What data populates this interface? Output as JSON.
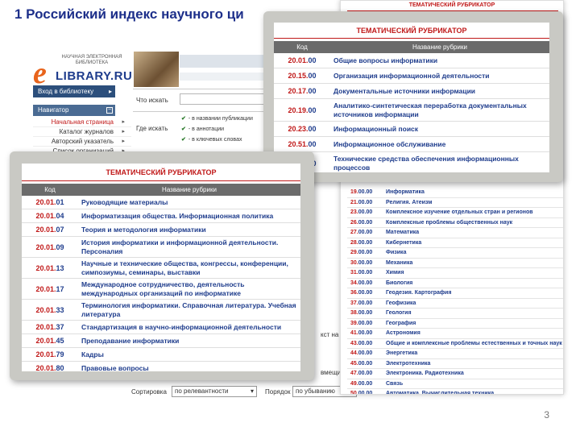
{
  "slide": {
    "title": "1 Российский индекс научного ци",
    "page_number": "3"
  },
  "elibrary": {
    "logo_small": "НАУЧНАЯ ЭЛЕКТРОННАЯ\nБИБЛИОТЕКА",
    "logo_e": "e",
    "logo_brand": "LIBRARY.RU",
    "login_button": "Вход в библиотеку",
    "navigator_header": "Навигатор",
    "nav_items": [
      {
        "label": "Начальная страница",
        "active": true
      },
      {
        "label": "Каталог журналов",
        "active": false
      },
      {
        "label": "Авторский указатель",
        "active": false
      },
      {
        "label": "Список организаций",
        "active": false
      }
    ],
    "search_label": "Что искать",
    "where_label": "Где искать",
    "where_options": [
      "- в названии публикации",
      "- в аннотации",
      "- в ключевых словах"
    ],
    "fragment_text_1": "кст на",
    "fragment_text_2": "вмещи",
    "sort_label": "Сортировка",
    "sort_value": "по релевантности",
    "order_label": "Порядок",
    "order_value": "по убыванию"
  },
  "big_rubricator": {
    "header": "ТЕМАТИЧЕСКИЙ РУБРИКАТОР",
    "rows": [
      {
        "prefix": "19.",
        "suffix": "00.00",
        "name": "Информатика"
      },
      {
        "prefix": "21.",
        "suffix": "00.00",
        "name": "Религия. Атеизм"
      },
      {
        "prefix": "23.",
        "suffix": "00.00",
        "name": "Комплексное изучение отдельных стран и регионов"
      },
      {
        "prefix": "26.",
        "suffix": "00.00",
        "name": "Комплексные проблемы общественных наук"
      },
      {
        "prefix": "27.",
        "suffix": "00.00",
        "name": "Математика"
      },
      {
        "prefix": "28.",
        "suffix": "00.00",
        "name": "Кибернетика"
      },
      {
        "prefix": "29.",
        "suffix": "00.00",
        "name": "Физика"
      },
      {
        "prefix": "30.",
        "suffix": "00.00",
        "name": "Механика"
      },
      {
        "prefix": "31.",
        "suffix": "00.00",
        "name": "Химия"
      },
      {
        "prefix": "34.",
        "suffix": "00.00",
        "name": "Биология"
      },
      {
        "prefix": "36.",
        "suffix": "00.00",
        "name": "Геодезия. Картография"
      },
      {
        "prefix": "37.",
        "suffix": "00.00",
        "name": "Геофизика"
      },
      {
        "prefix": "38.",
        "suffix": "00.00",
        "name": "Геология"
      },
      {
        "prefix": "39.",
        "suffix": "00.00",
        "name": "География"
      },
      {
        "prefix": "41.",
        "suffix": "00.00",
        "name": "Астрономия"
      },
      {
        "prefix": "43.",
        "suffix": "00.00",
        "name": "Общие и комплексные проблемы естественных и точных наук"
      },
      {
        "prefix": "44.",
        "suffix": "00.00",
        "name": "Энергетика"
      },
      {
        "prefix": "45.",
        "suffix": "00.00",
        "name": "Электротехника"
      },
      {
        "prefix": "47.",
        "suffix": "00.00",
        "name": "Электроника. Радиотехника"
      },
      {
        "prefix": "49.",
        "suffix": "00.00",
        "name": "Связь"
      },
      {
        "prefix": "50.",
        "suffix": "00.00",
        "name": "Автоматика. Вычислительная техника"
      }
    ]
  },
  "rubricator_top": {
    "header": "ТЕМАТИЧЕСКИЙ РУБРИКАТОР",
    "col_code": "Код",
    "col_name": "Название рубрики",
    "rows": [
      {
        "prefix": "20.01.",
        "suffix": "00",
        "name": "Общие вопросы информатики"
      },
      {
        "prefix": "20.15.",
        "suffix": "00",
        "name": "Организация информационной деятельности"
      },
      {
        "prefix": "20.17.",
        "suffix": "00",
        "name": "Документальные источники информации"
      },
      {
        "prefix": "20.19.",
        "suffix": "00",
        "name": "Аналитико-синтетическая переработка документальных источников информации"
      },
      {
        "prefix": "20.23.",
        "suffix": "00",
        "name": "Информационный поиск"
      },
      {
        "prefix": "20.51.",
        "suffix": "00",
        "name": "Информационное обслуживание"
      },
      {
        "prefix": "20.53.",
        "suffix": "00",
        "name": "Технические средства обеспечения информационных процессов"
      }
    ]
  },
  "rubricator_bottom": {
    "header": "ТЕМАТИЧЕСКИЙ РУБРИКАТОР",
    "col_code": "Код",
    "col_name": "Название рубрики",
    "rows": [
      {
        "prefix": "20.01.",
        "suffix": "01",
        "name": "Руководящие материалы"
      },
      {
        "prefix": "20.01.",
        "suffix": "04",
        "name": "Информатизация общества. Информационная политика"
      },
      {
        "prefix": "20.01.",
        "suffix": "07",
        "name": "Теория и методология информатики"
      },
      {
        "prefix": "20.01.",
        "suffix": "09",
        "name": "История информатики и информационной деятельности. Персоналия"
      },
      {
        "prefix": "20.01.",
        "suffix": "13",
        "name": "Научные и технические общества, конгрессы, конференции, симпозиумы, семинары, выставки"
      },
      {
        "prefix": "20.01.",
        "suffix": "17",
        "name": "Международное сотрудничество, деятельность международных организаций по информатике"
      },
      {
        "prefix": "20.01.",
        "suffix": "33",
        "name": "Терминология информатики. Справочная литература. Учебная литература"
      },
      {
        "prefix": "20.01.",
        "suffix": "37",
        "name": "Стандартизация в научно-информационной деятельности"
      },
      {
        "prefix": "20.01.",
        "suffix": "45",
        "name": "Преподавание информатики"
      },
      {
        "prefix": "20.01.",
        "suffix": "79",
        "name": "Кадры"
      },
      {
        "prefix": "20.01.",
        "suffix": "80",
        "name": "Правовые вопросы"
      }
    ]
  }
}
